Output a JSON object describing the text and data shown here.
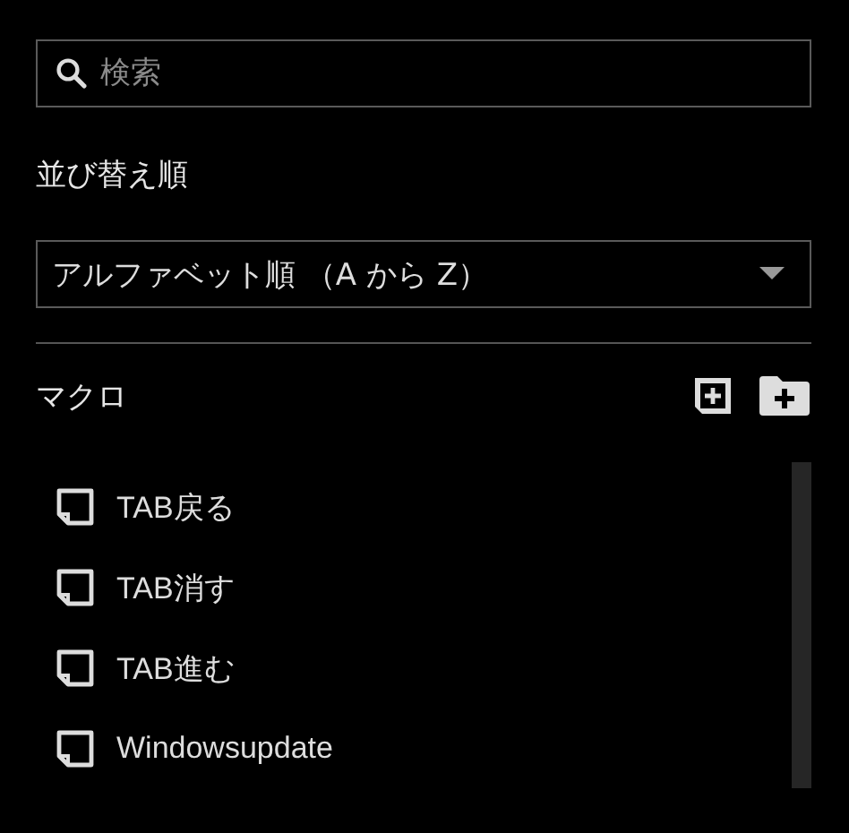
{
  "search": {
    "placeholder": "検索"
  },
  "sort": {
    "label": "並び替え順",
    "value": "アルファベット順 （A から Z）"
  },
  "macros": {
    "title": "マクロ",
    "items": [
      {
        "name": "TAB戻る"
      },
      {
        "name": "TAB消す"
      },
      {
        "name": "TAB進む"
      },
      {
        "name": "Windowsupdate"
      }
    ]
  }
}
